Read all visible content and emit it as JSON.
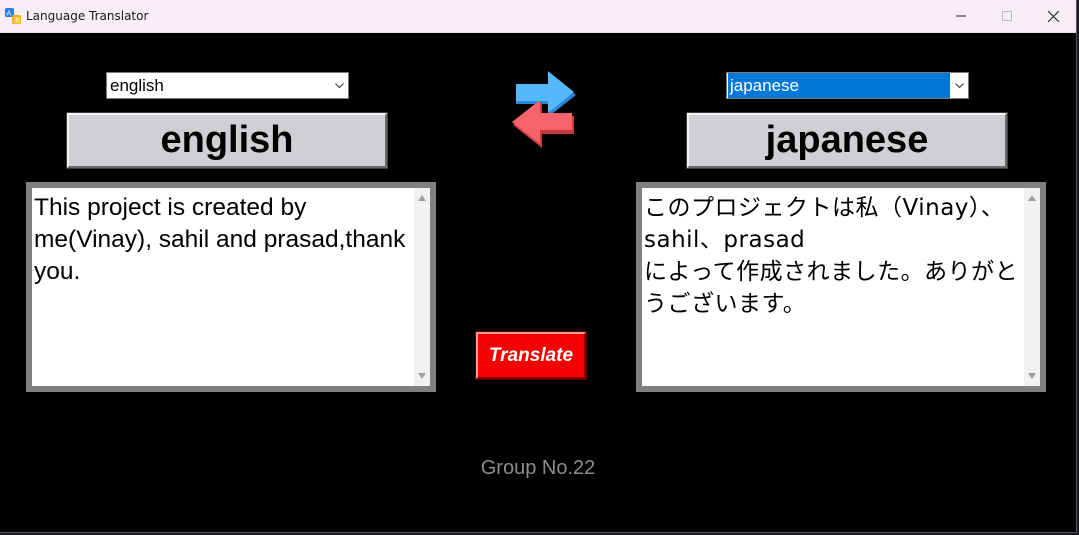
{
  "window": {
    "title": "Language Translator",
    "controls": {
      "minimize": "minimize-icon",
      "maximize": "maximize-icon",
      "close": "close-icon"
    }
  },
  "source": {
    "selected_language": "english",
    "label": "english",
    "text": "This project is created by me(Vinay), sahil and prasad,thank you."
  },
  "target": {
    "selected_language": "japanese",
    "label": "japanese",
    "text": "このプロジェクトは私（Vinay）、sahil、prasad\nによって作成されました。ありがとうございます。"
  },
  "swap_icon": "swap-arrows-icon",
  "translate_label": "Translate",
  "footer": "Group No.22",
  "colors": {
    "background": "#000000",
    "translate_button": "#f40000",
    "swap_arrow_top": "#47a9f5",
    "swap_arrow_bottom": "#f2555c",
    "selection_highlight": "#0078d7"
  }
}
